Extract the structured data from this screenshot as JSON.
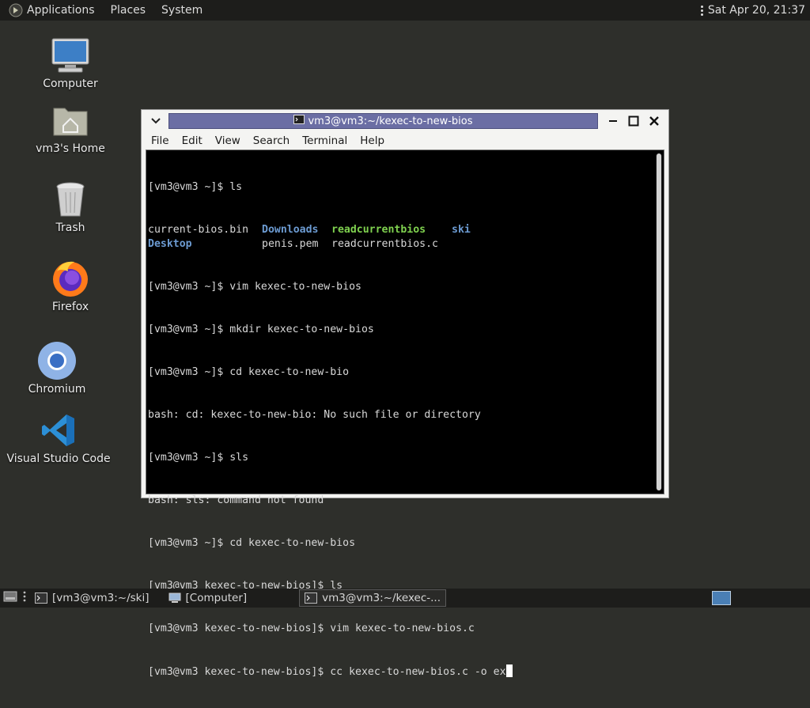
{
  "top_panel": {
    "applications": "Applications",
    "places": "Places",
    "system": "System",
    "clock": "Sat Apr 20, 21:37"
  },
  "desktop_icons": [
    {
      "label": "Computer",
      "icon": "computer-icon"
    },
    {
      "label": "vm3's Home",
      "icon": "home-folder-icon"
    },
    {
      "label": "Trash",
      "icon": "trash-icon"
    },
    {
      "label": "Firefox",
      "icon": "firefox-icon"
    },
    {
      "label": "Chromium",
      "icon": "chromium-icon"
    },
    {
      "label": "Visual Studio Code",
      "icon": "vscode-icon"
    }
  ],
  "window": {
    "title": "vm3@vm3:~/kexec-to-new-bios",
    "menu": [
      "File",
      "Edit",
      "View",
      "Search",
      "Terminal",
      "Help"
    ]
  },
  "terminal": {
    "line_ls": "[vm3@vm3 ~]$ ls",
    "ls_columns": [
      [
        {
          "text": "current-bios.bin",
          "kind": "file"
        },
        {
          "text": "Desktop",
          "kind": "dir"
        }
      ],
      [
        {
          "text": "Downloads",
          "kind": "dir"
        },
        {
          "text": "penis.pem",
          "kind": "file"
        }
      ],
      [
        {
          "text": "readcurrentbios",
          "kind": "exe"
        },
        {
          "text": "readcurrentbios.c",
          "kind": "file"
        }
      ],
      [
        {
          "text": "ski",
          "kind": "dir"
        },
        {
          "text": "",
          "kind": "file"
        }
      ]
    ],
    "lines": [
      "[vm3@vm3 ~]$ vim kexec-to-new-bios",
      "[vm3@vm3 ~]$ mkdir kexec-to-new-bios",
      "[vm3@vm3 ~]$ cd kexec-to-new-bio",
      "bash: cd: kexec-to-new-bio: No such file or directory",
      "[vm3@vm3 ~]$ sls",
      "bash: sls: command not found",
      "[vm3@vm3 ~]$ cd kexec-to-new-bios",
      "[vm3@vm3 kexec-to-new-bios]$ ls",
      "[vm3@vm3 kexec-to-new-bios]$ vim kexec-to-new-bios.c"
    ],
    "current_line": "[vm3@vm3 kexec-to-new-bios]$ cc kexec-to-new-bios.c -o ex"
  },
  "taskbar": {
    "tasks": [
      {
        "label": "[vm3@vm3:~/ski]",
        "icon": "terminal-icon",
        "active": false
      },
      {
        "label": "[Computer]",
        "icon": "computer-icon",
        "active": false
      },
      {
        "label": "vm3@vm3:~/kexec-...",
        "icon": "terminal-icon",
        "active": true
      }
    ]
  },
  "colors": {
    "directory": "#6c9bd2",
    "executable": "#7fd14f",
    "titlebar_active": "#6b6ea4"
  }
}
